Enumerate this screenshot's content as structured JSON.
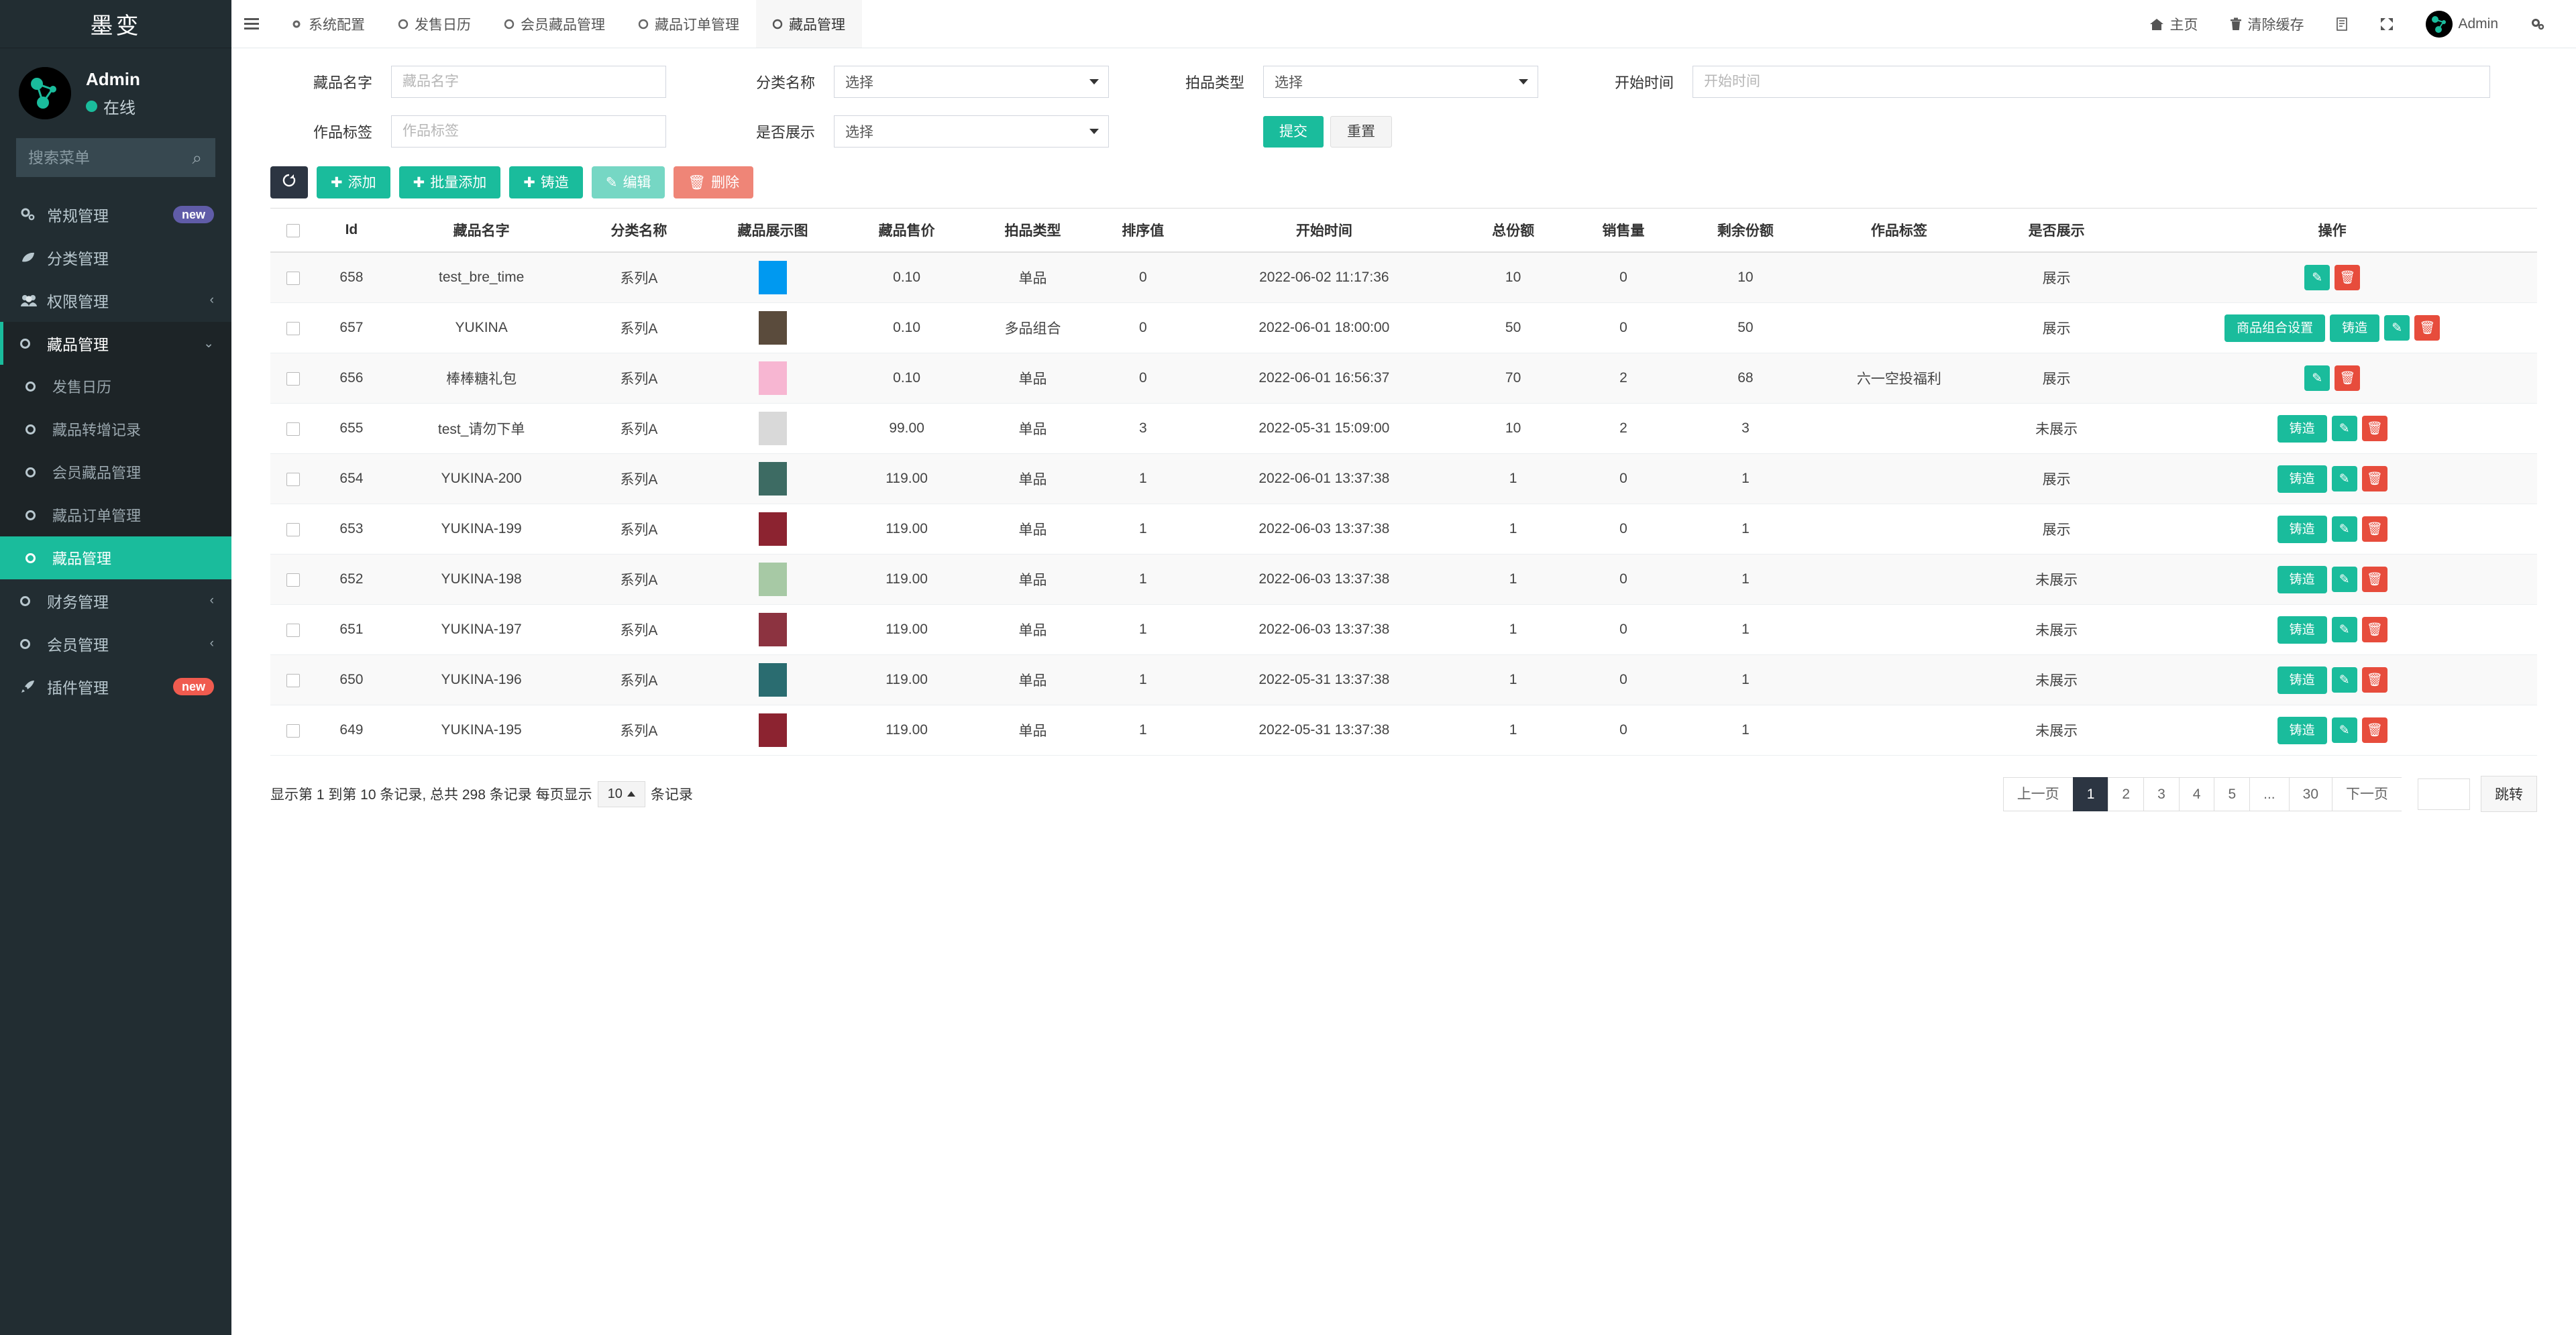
{
  "sidebar": {
    "brand": "墨变",
    "user": {
      "name": "Admin",
      "status": "在线",
      "avatar_icon": "molecule-logo-icon"
    },
    "search": {
      "placeholder": "搜索菜单",
      "value": "",
      "icon": "search-icon"
    },
    "items": [
      {
        "label": "常规管理",
        "icon": "gears-icon",
        "badge": "new",
        "badge_color": "#605ca8",
        "chevron": ""
      },
      {
        "label": "分类管理",
        "icon": "leaf-icon",
        "badge": "",
        "chevron": ""
      },
      {
        "label": "权限管理",
        "icon": "users-icon",
        "badge": "",
        "chevron": "‹"
      },
      {
        "label": "藏品管理",
        "icon": "circle-o-icon",
        "badge": "",
        "chevron": "⌄",
        "expanded": true
      }
    ],
    "submenu": [
      {
        "label": "发售日历",
        "icon": "circle-o-icon",
        "active": false
      },
      {
        "label": "藏品转增记录",
        "icon": "circle-o-icon",
        "active": false
      },
      {
        "label": "会员藏品管理",
        "icon": "circle-o-icon",
        "active": false
      },
      {
        "label": "藏品订单管理",
        "icon": "circle-o-icon",
        "active": false
      },
      {
        "label": "藏品管理",
        "icon": "circle-o-icon",
        "active": true
      }
    ],
    "items_after": [
      {
        "label": "财务管理",
        "icon": "circle-o-icon",
        "badge": "",
        "chevron": "‹"
      },
      {
        "label": "会员管理",
        "icon": "circle-o-icon",
        "badge": "",
        "chevron": "‹"
      },
      {
        "label": "插件管理",
        "icon": "rocket-icon",
        "badge": "new",
        "badge_color": "#f05b4f",
        "chevron": ""
      }
    ]
  },
  "topbar": {
    "hamburger_icon": "hamburger-icon",
    "tabs": [
      {
        "label": "系统配置",
        "icon": "gear-icon",
        "active": false
      },
      {
        "label": "发售日历",
        "icon": "circle-o-icon",
        "active": false
      },
      {
        "label": "会员藏品管理",
        "icon": "circle-o-icon",
        "active": false
      },
      {
        "label": "藏品订单管理",
        "icon": "circle-o-icon",
        "active": false
      },
      {
        "label": "藏品管理",
        "icon": "circle-o-icon",
        "active": true
      }
    ],
    "right": [
      {
        "label": "主页",
        "icon": "home-icon"
      },
      {
        "label": "清除缓存",
        "icon": "trash-icon"
      },
      {
        "label": "",
        "icon": "theme-icon"
      },
      {
        "label": "",
        "icon": "fullscreen-icon"
      },
      {
        "label": "Admin",
        "icon": "avatar-icon"
      },
      {
        "label": "",
        "icon": "gears-icon"
      }
    ]
  },
  "filters": {
    "name_label": "藏品名字",
    "name_placeholder": "藏品名字",
    "name_value": "",
    "tag_label": "作品标签",
    "tag_placeholder": "作品标签",
    "tag_value": "",
    "category_label": "分类名称",
    "category_value": "选择",
    "show_label": "是否展示",
    "show_value": "选择",
    "auction_label": "拍品类型",
    "auction_value": "选择",
    "start_label": "开始时间",
    "start_placeholder": "开始时间",
    "start_value": "",
    "submit_label": "提交",
    "reset_label": "重置"
  },
  "toolbar": {
    "refresh_icon": "refresh-icon",
    "add_label": "添加",
    "batch_add_label": "批量添加",
    "mint_label": "铸造",
    "edit_label": "编辑",
    "delete_label": "删除"
  },
  "table": {
    "columns": [
      "",
      "Id",
      "藏品名字",
      "分类名称",
      "藏品展示图",
      "藏品售价",
      "拍品类型",
      "排序值",
      "开始时间",
      "总份额",
      "销售量",
      "剩余份额",
      "作品标签",
      "是否展示",
      "操作"
    ],
    "rows": [
      {
        "id": "658",
        "name": "test_bre_time",
        "category": "系列A",
        "thumb_color": "#0099f0",
        "price": "0.10",
        "auction_type": "单品",
        "auction_highlight": false,
        "sort": "0",
        "start_time": "2022-06-02 11:17:36",
        "total": "10",
        "sold": "0",
        "remain": "10",
        "tag": "",
        "show": "展示",
        "show_on": true,
        "ops": [
          "edit",
          "delete"
        ]
      },
      {
        "id": "657",
        "name": "YUKINA",
        "category": "系列A",
        "thumb_color": "#5a4b3c",
        "price": "0.10",
        "auction_type": "多品组合",
        "auction_highlight": true,
        "sort": "0",
        "start_time": "2022-06-01 18:00:00",
        "total": "50",
        "sold": "0",
        "remain": "50",
        "tag": "",
        "show": "展示",
        "show_on": true,
        "ops": [
          "商品组合设置",
          "铸造",
          "edit",
          "delete"
        ]
      },
      {
        "id": "656",
        "name": "棒棒糖礼包",
        "category": "系列A",
        "thumb_color": "#f7b6d2",
        "price": "0.10",
        "auction_type": "单品",
        "auction_highlight": false,
        "sort": "0",
        "start_time": "2022-06-01 16:56:37",
        "total": "70",
        "sold": "2",
        "remain": "68",
        "tag": "六一空投福利",
        "show": "展示",
        "show_on": true,
        "ops": [
          "edit",
          "delete"
        ]
      },
      {
        "id": "655",
        "name": "test_请勿下单",
        "category": "系列A",
        "thumb_color": "#d9d9d9",
        "price": "99.00",
        "auction_type": "单品",
        "auction_highlight": false,
        "sort": "3",
        "start_time": "2022-05-31 15:09:00",
        "total": "10",
        "sold": "2",
        "remain": "3",
        "tag": "",
        "show": "未展示",
        "show_on": false,
        "ops": [
          "铸造",
          "edit",
          "delete"
        ]
      },
      {
        "id": "654",
        "name": "YUKINA-200",
        "category": "系列A",
        "thumb_color": "#3d6b63",
        "price": "119.00",
        "auction_type": "单品",
        "auction_highlight": false,
        "sort": "1",
        "start_time": "2022-06-01 13:37:38",
        "total": "1",
        "sold": "0",
        "remain": "1",
        "tag": "",
        "show": "展示",
        "show_on": true,
        "ops": [
          "铸造",
          "edit",
          "delete"
        ]
      },
      {
        "id": "653",
        "name": "YUKINA-199",
        "category": "系列A",
        "thumb_color": "#8c2330",
        "price": "119.00",
        "auction_type": "单品",
        "auction_highlight": false,
        "sort": "1",
        "start_time": "2022-06-03 13:37:38",
        "total": "1",
        "sold": "0",
        "remain": "1",
        "tag": "",
        "show": "展示",
        "show_on": true,
        "ops": [
          "铸造",
          "edit",
          "delete"
        ]
      },
      {
        "id": "652",
        "name": "YUKINA-198",
        "category": "系列A",
        "thumb_color": "#a7c9a5",
        "price": "119.00",
        "auction_type": "单品",
        "auction_highlight": false,
        "sort": "1",
        "start_time": "2022-06-03 13:37:38",
        "total": "1",
        "sold": "0",
        "remain": "1",
        "tag": "",
        "show": "未展示",
        "show_on": false,
        "ops": [
          "铸造",
          "edit",
          "delete"
        ]
      },
      {
        "id": "651",
        "name": "YUKINA-197",
        "category": "系列A",
        "thumb_color": "#8c3340",
        "price": "119.00",
        "auction_type": "单品",
        "auction_highlight": false,
        "sort": "1",
        "start_time": "2022-06-03 13:37:38",
        "total": "1",
        "sold": "0",
        "remain": "1",
        "tag": "",
        "show": "未展示",
        "show_on": false,
        "ops": [
          "铸造",
          "edit",
          "delete"
        ]
      },
      {
        "id": "650",
        "name": "YUKINA-196",
        "category": "系列A",
        "thumb_color": "#2a6c70",
        "price": "119.00",
        "auction_type": "单品",
        "auction_highlight": false,
        "sort": "1",
        "start_time": "2022-05-31 13:37:38",
        "total": "1",
        "sold": "0",
        "remain": "1",
        "tag": "",
        "show": "未展示",
        "show_on": false,
        "ops": [
          "铸造",
          "edit",
          "delete"
        ]
      },
      {
        "id": "649",
        "name": "YUKINA-195",
        "category": "系列A",
        "thumb_color": "#8c2330",
        "price": "119.00",
        "auction_type": "单品",
        "auction_highlight": false,
        "sort": "1",
        "start_time": "2022-05-31 13:37:38",
        "total": "1",
        "sold": "0",
        "remain": "1",
        "tag": "",
        "show": "未展示",
        "show_on": false,
        "ops": [
          "铸造",
          "edit",
          "delete"
        ]
      }
    ]
  },
  "footer": {
    "summary_prefix": "显示第 1 到第 10 条记录, 总共 298 条记录 每页显示",
    "page_size": "10",
    "summary_suffix": "条记录",
    "prev_label": "上一页",
    "pages": [
      "1",
      "2",
      "3",
      "4",
      "5",
      "...",
      "30"
    ],
    "active_page": "1",
    "next_label": "下一页",
    "jump_value": "",
    "jump_label": "跳转"
  }
}
